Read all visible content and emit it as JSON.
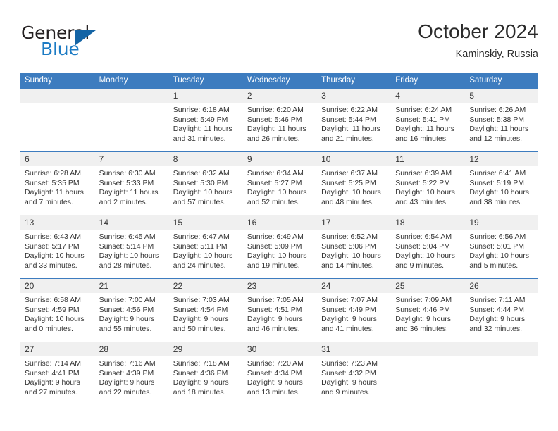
{
  "logo": {
    "word_top": "General",
    "word_bottom": "Blue",
    "triangle_color": "#1464a5",
    "blue_color": "#1c7bc4"
  },
  "header": {
    "month_title": "October 2024",
    "location": "Kaminskiy, Russia"
  },
  "theme": {
    "header_blue": "#3d7cbf",
    "daynum_gray": "#f0f0f0",
    "grid_line": "#e2e2e2"
  },
  "weekday_headers": [
    "Sunday",
    "Monday",
    "Tuesday",
    "Wednesday",
    "Thursday",
    "Friday",
    "Saturday"
  ],
  "labels": {
    "sunrise_prefix": "Sunrise:",
    "sunset_prefix": "Sunset:",
    "daylight_prefix": "Daylight:"
  },
  "weeks": [
    [
      {
        "date": "",
        "empty": true
      },
      {
        "date": "",
        "empty": true
      },
      {
        "date": "1",
        "sunrise": "Sunrise: 6:18 AM",
        "sunset": "Sunset: 5:49 PM",
        "daylight": "Daylight: 11 hours and 31 minutes."
      },
      {
        "date": "2",
        "sunrise": "Sunrise: 6:20 AM",
        "sunset": "Sunset: 5:46 PM",
        "daylight": "Daylight: 11 hours and 26 minutes."
      },
      {
        "date": "3",
        "sunrise": "Sunrise: 6:22 AM",
        "sunset": "Sunset: 5:44 PM",
        "daylight": "Daylight: 11 hours and 21 minutes."
      },
      {
        "date": "4",
        "sunrise": "Sunrise: 6:24 AM",
        "sunset": "Sunset: 5:41 PM",
        "daylight": "Daylight: 11 hours and 16 minutes."
      },
      {
        "date": "5",
        "sunrise": "Sunrise: 6:26 AM",
        "sunset": "Sunset: 5:38 PM",
        "daylight": "Daylight: 11 hours and 12 minutes."
      }
    ],
    [
      {
        "date": "6",
        "sunrise": "Sunrise: 6:28 AM",
        "sunset": "Sunset: 5:35 PM",
        "daylight": "Daylight: 11 hours and 7 minutes."
      },
      {
        "date": "7",
        "sunrise": "Sunrise: 6:30 AM",
        "sunset": "Sunset: 5:33 PM",
        "daylight": "Daylight: 11 hours and 2 minutes."
      },
      {
        "date": "8",
        "sunrise": "Sunrise: 6:32 AM",
        "sunset": "Sunset: 5:30 PM",
        "daylight": "Daylight: 10 hours and 57 minutes."
      },
      {
        "date": "9",
        "sunrise": "Sunrise: 6:34 AM",
        "sunset": "Sunset: 5:27 PM",
        "daylight": "Daylight: 10 hours and 52 minutes."
      },
      {
        "date": "10",
        "sunrise": "Sunrise: 6:37 AM",
        "sunset": "Sunset: 5:25 PM",
        "daylight": "Daylight: 10 hours and 48 minutes."
      },
      {
        "date": "11",
        "sunrise": "Sunrise: 6:39 AM",
        "sunset": "Sunset: 5:22 PM",
        "daylight": "Daylight: 10 hours and 43 minutes."
      },
      {
        "date": "12",
        "sunrise": "Sunrise: 6:41 AM",
        "sunset": "Sunset: 5:19 PM",
        "daylight": "Daylight: 10 hours and 38 minutes."
      }
    ],
    [
      {
        "date": "13",
        "sunrise": "Sunrise: 6:43 AM",
        "sunset": "Sunset: 5:17 PM",
        "daylight": "Daylight: 10 hours and 33 minutes."
      },
      {
        "date": "14",
        "sunrise": "Sunrise: 6:45 AM",
        "sunset": "Sunset: 5:14 PM",
        "daylight": "Daylight: 10 hours and 28 minutes."
      },
      {
        "date": "15",
        "sunrise": "Sunrise: 6:47 AM",
        "sunset": "Sunset: 5:11 PM",
        "daylight": "Daylight: 10 hours and 24 minutes."
      },
      {
        "date": "16",
        "sunrise": "Sunrise: 6:49 AM",
        "sunset": "Sunset: 5:09 PM",
        "daylight": "Daylight: 10 hours and 19 minutes."
      },
      {
        "date": "17",
        "sunrise": "Sunrise: 6:52 AM",
        "sunset": "Sunset: 5:06 PM",
        "daylight": "Daylight: 10 hours and 14 minutes."
      },
      {
        "date": "18",
        "sunrise": "Sunrise: 6:54 AM",
        "sunset": "Sunset: 5:04 PM",
        "daylight": "Daylight: 10 hours and 9 minutes."
      },
      {
        "date": "19",
        "sunrise": "Sunrise: 6:56 AM",
        "sunset": "Sunset: 5:01 PM",
        "daylight": "Daylight: 10 hours and 5 minutes."
      }
    ],
    [
      {
        "date": "20",
        "sunrise": "Sunrise: 6:58 AM",
        "sunset": "Sunset: 4:59 PM",
        "daylight": "Daylight: 10 hours and 0 minutes."
      },
      {
        "date": "21",
        "sunrise": "Sunrise: 7:00 AM",
        "sunset": "Sunset: 4:56 PM",
        "daylight": "Daylight: 9 hours and 55 minutes."
      },
      {
        "date": "22",
        "sunrise": "Sunrise: 7:03 AM",
        "sunset": "Sunset: 4:54 PM",
        "daylight": "Daylight: 9 hours and 50 minutes."
      },
      {
        "date": "23",
        "sunrise": "Sunrise: 7:05 AM",
        "sunset": "Sunset: 4:51 PM",
        "daylight": "Daylight: 9 hours and 46 minutes."
      },
      {
        "date": "24",
        "sunrise": "Sunrise: 7:07 AM",
        "sunset": "Sunset: 4:49 PM",
        "daylight": "Daylight: 9 hours and 41 minutes."
      },
      {
        "date": "25",
        "sunrise": "Sunrise: 7:09 AM",
        "sunset": "Sunset: 4:46 PM",
        "daylight": "Daylight: 9 hours and 36 minutes."
      },
      {
        "date": "26",
        "sunrise": "Sunrise: 7:11 AM",
        "sunset": "Sunset: 4:44 PM",
        "daylight": "Daylight: 9 hours and 32 minutes."
      }
    ],
    [
      {
        "date": "27",
        "sunrise": "Sunrise: 7:14 AM",
        "sunset": "Sunset: 4:41 PM",
        "daylight": "Daylight: 9 hours and 27 minutes."
      },
      {
        "date": "28",
        "sunrise": "Sunrise: 7:16 AM",
        "sunset": "Sunset: 4:39 PM",
        "daylight": "Daylight: 9 hours and 22 minutes."
      },
      {
        "date": "29",
        "sunrise": "Sunrise: 7:18 AM",
        "sunset": "Sunset: 4:36 PM",
        "daylight": "Daylight: 9 hours and 18 minutes."
      },
      {
        "date": "30",
        "sunrise": "Sunrise: 7:20 AM",
        "sunset": "Sunset: 4:34 PM",
        "daylight": "Daylight: 9 hours and 13 minutes."
      },
      {
        "date": "31",
        "sunrise": "Sunrise: 7:23 AM",
        "sunset": "Sunset: 4:32 PM",
        "daylight": "Daylight: 9 hours and 9 minutes."
      },
      {
        "date": "",
        "empty": true
      },
      {
        "date": "",
        "empty": true
      }
    ]
  ]
}
